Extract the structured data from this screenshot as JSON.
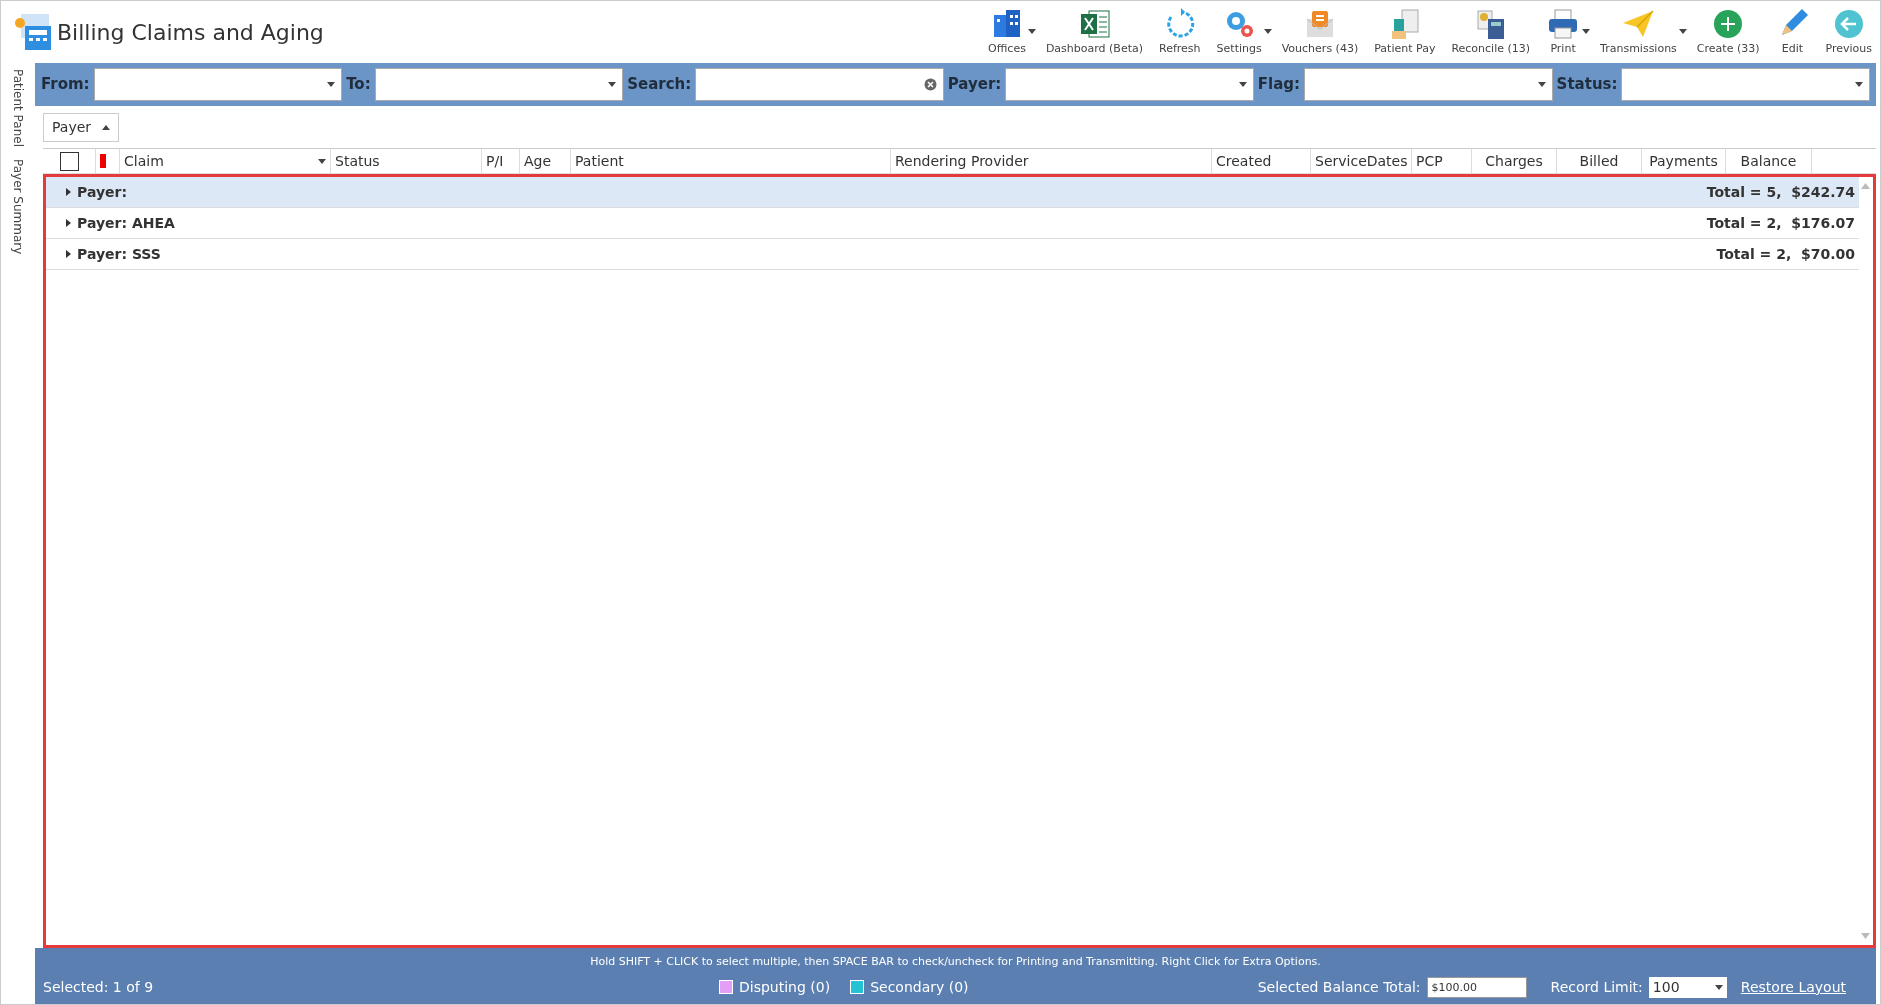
{
  "window": {
    "title": "Billing Claims and Aging"
  },
  "toolbar": [
    {
      "label": "Offices",
      "dropdown": true
    },
    {
      "label": "Dashboard (Beta)",
      "dropdown": false
    },
    {
      "label": "Refresh",
      "dropdown": false
    },
    {
      "label": "Settings",
      "dropdown": true
    },
    {
      "label": "Vouchers (43)",
      "dropdown": false
    },
    {
      "label": "Patient Pay",
      "dropdown": false
    },
    {
      "label": "Reconcile (13)",
      "dropdown": false
    },
    {
      "label": "Print",
      "dropdown": true
    },
    {
      "label": "Transmissions",
      "dropdown": true
    },
    {
      "label": "Create (33)",
      "dropdown": false
    },
    {
      "label": "Edit",
      "dropdown": false
    },
    {
      "label": "Previous",
      "dropdown": false
    }
  ],
  "side_tabs": [
    "Patient Panel",
    "Payer Summary"
  ],
  "filters": [
    {
      "label": "From:",
      "kind": "select"
    },
    {
      "label": "To:",
      "kind": "select"
    },
    {
      "label": "Search:",
      "kind": "search"
    },
    {
      "label": "Payer:",
      "kind": "select"
    },
    {
      "label": "Flag:",
      "kind": "select"
    },
    {
      "label": "Status:",
      "kind": "select"
    }
  ],
  "group_by": {
    "label": "Payer"
  },
  "table": {
    "columns": [
      "Claim",
      "Status",
      "P/I",
      "Age",
      "Patient",
      "Rendering Provider",
      "Created",
      "ServiceDates",
      "PCP",
      "Charges",
      "Billed",
      "Payments",
      "Balance"
    ],
    "select_all_checked": false,
    "groups": [
      {
        "label": "Payer:",
        "total": "Total = 5,  $242.74",
        "selected": true,
        "expanded": false
      },
      {
        "label": "Payer: AHEA",
        "total": "Total = 2,  $176.07",
        "selected": false,
        "expanded": false
      },
      {
        "label": "Payer: SSS",
        "total": "Total = 2,  $70.00",
        "selected": false,
        "expanded": false
      }
    ]
  },
  "status_bar": {
    "hint": "Hold SHIFT + CLICK to select multiple, then SPACE BAR to check/uncheck for Printing and Transmitting. Right Click for Extra Options.",
    "selected": "Selected: 1 of 9",
    "legend": [
      {
        "label": "Disputing (0)",
        "color": "#e39ff6"
      },
      {
        "label": "Secondary (0)",
        "color": "#25c2d6"
      }
    ],
    "balance_label": "Selected Balance Total:",
    "balance_value": "$100.00",
    "limit_label": "Record Limit:",
    "limit_value": "100",
    "restore": "Restore Layout"
  }
}
